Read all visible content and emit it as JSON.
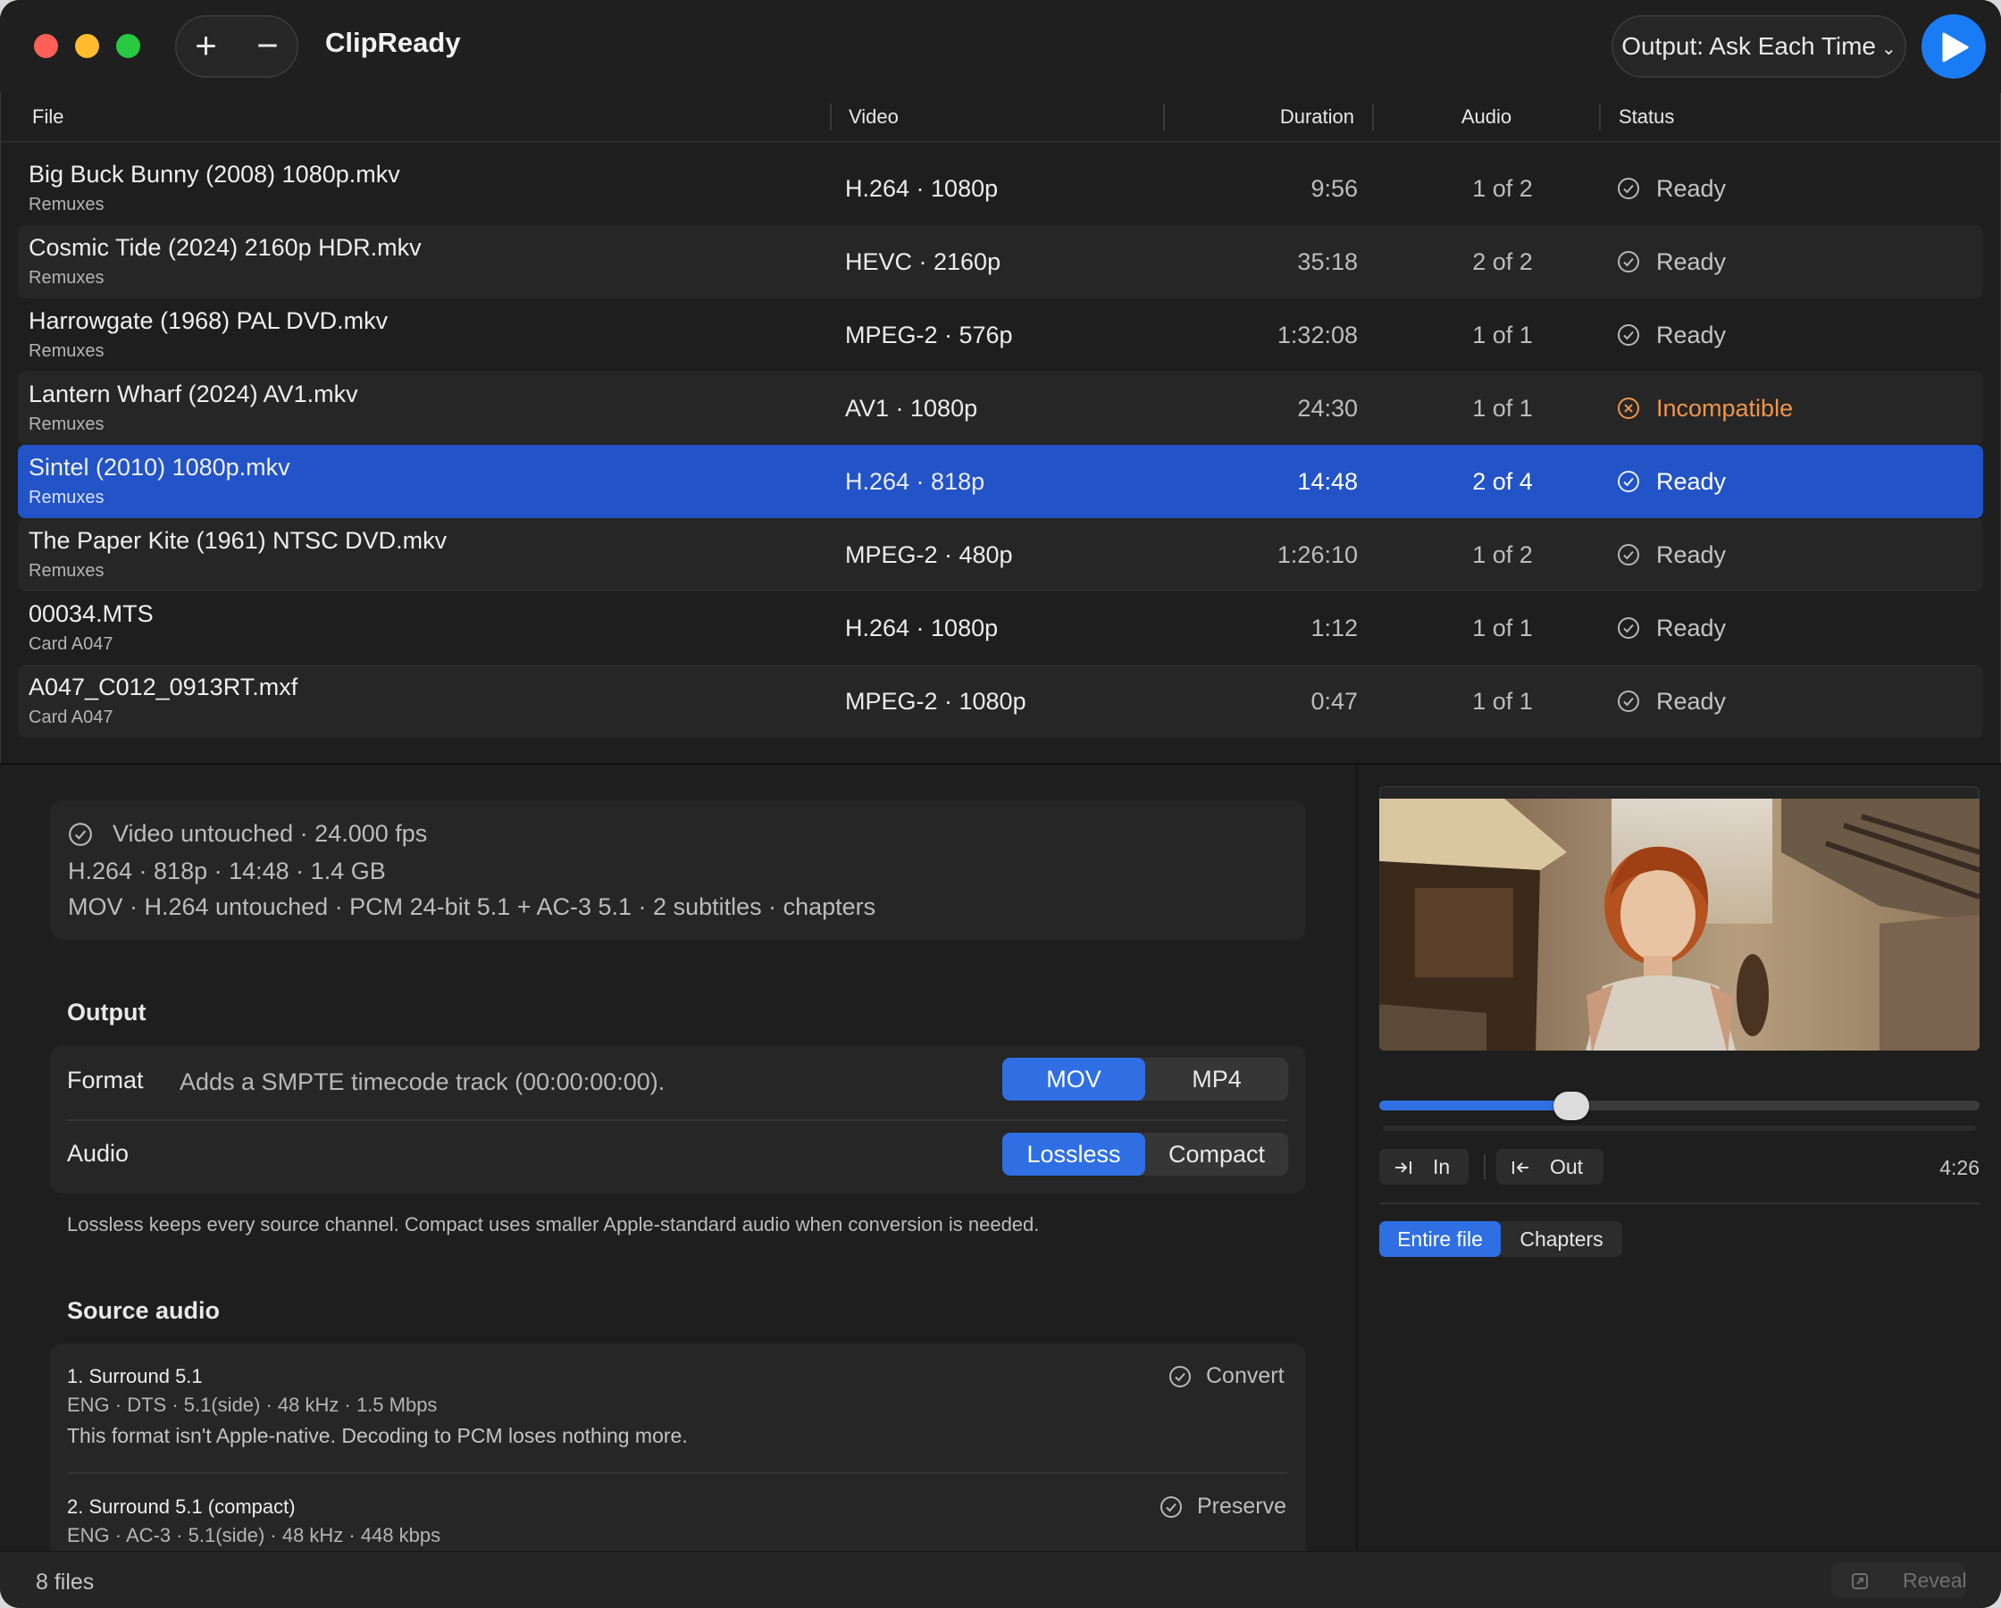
{
  "app": {
    "title": "ClipReady",
    "output_label": "Output: Ask Each Time"
  },
  "toolbar": {
    "add": "+",
    "remove": "−"
  },
  "table": {
    "headers": {
      "file": "File",
      "video": "Video",
      "duration": "Duration",
      "audio": "Audio",
      "status": "Status"
    },
    "rows": [
      {
        "name": "Big Buck Bunny (2008) 1080p.mkv",
        "folder": "Remuxes",
        "video": "H.264 · 1080p",
        "duration": "9:56",
        "audio": "1 of 2",
        "status": "Ready"
      },
      {
        "name": "Cosmic Tide (2024) 2160p HDR.mkv",
        "folder": "Remuxes",
        "video": "HEVC · 2160p",
        "duration": "35:18",
        "audio": "2 of 2",
        "status": "Ready"
      },
      {
        "name": "Harrowgate (1968) PAL DVD.mkv",
        "folder": "Remuxes",
        "video": "MPEG-2 · 576p",
        "duration": "1:32:08",
        "audio": "1 of 1",
        "status": "Ready"
      },
      {
        "name": "Lantern Wharf (2024) AV1.mkv",
        "folder": "Remuxes",
        "video": "AV1 · 1080p",
        "duration": "24:30",
        "audio": "1 of 1",
        "status": "Incompatible"
      },
      {
        "name": "Sintel (2010) 1080p.mkv",
        "folder": "Remuxes",
        "video": "H.264 · 818p",
        "duration": "14:48",
        "audio": "2 of 4",
        "status": "Ready"
      },
      {
        "name": "The Paper Kite (1961) NTSC DVD.mkv",
        "folder": "Remuxes",
        "video": "MPEG-2 · 480p",
        "duration": "1:26:10",
        "audio": "1 of 2",
        "status": "Ready"
      },
      {
        "name": "00034.MTS",
        "folder": "Card A047",
        "video": "H.264 · 1080p",
        "duration": "1:12",
        "audio": "1 of 1",
        "status": "Ready"
      },
      {
        "name": "A047_C012_0913RT.mxf",
        "folder": "Card A047",
        "video": "MPEG-2 · 1080p",
        "duration": "0:47",
        "audio": "1 of 1",
        "status": "Ready"
      }
    ]
  },
  "detail": {
    "summary": {
      "line1": "Video untouched · 24.000 fps",
      "line2": "H.264 · 818p · 14:48 · 1.4 GB",
      "line3": "MOV · H.264 untouched · PCM 24-bit 5.1 + AC-3 5.1 · 2 subtitles · chapters"
    },
    "output_heading": "Output",
    "format_label": "Format",
    "format_desc": "Adds a SMPTE timecode track (00:00:00:00).",
    "format_options": [
      "MOV",
      "MP4"
    ],
    "format_selected": "MOV",
    "audio_label": "Audio",
    "audio_options": [
      "Lossless",
      "Compact"
    ],
    "audio_selected": "Lossless",
    "audio_note": "Lossless keeps every source channel. Compact uses smaller Apple-standard audio when conversion is needed.",
    "source_audio_heading": "Source audio",
    "tracks": [
      {
        "title": "1. Surround 5.1",
        "meta": "ENG · DTS · 5.1(side) · 48 kHz · 1.5 Mbps",
        "note": "This format isn't Apple-native. Decoding to PCM loses nothing more.",
        "action": "Convert"
      },
      {
        "title": "2. Surround 5.1 (compact)",
        "meta": "ENG · AC-3 · 5.1(side) · 48 kHz · 448 kbps",
        "note": "",
        "action": "Preserve"
      }
    ]
  },
  "preview": {
    "scrub_fraction": 0.32,
    "in_label": "In",
    "out_label": "Out",
    "duration": "4:26",
    "tabs": [
      "Entire file",
      "Chapters"
    ],
    "tab_selected": "Entire file"
  },
  "footer": {
    "count": "8 files",
    "reveal": "Reveal"
  },
  "colors": {
    "accent": "#2f6fe3",
    "selection": "#2253c7",
    "warning": "#f0954a",
    "play": "#1a7cf5"
  }
}
